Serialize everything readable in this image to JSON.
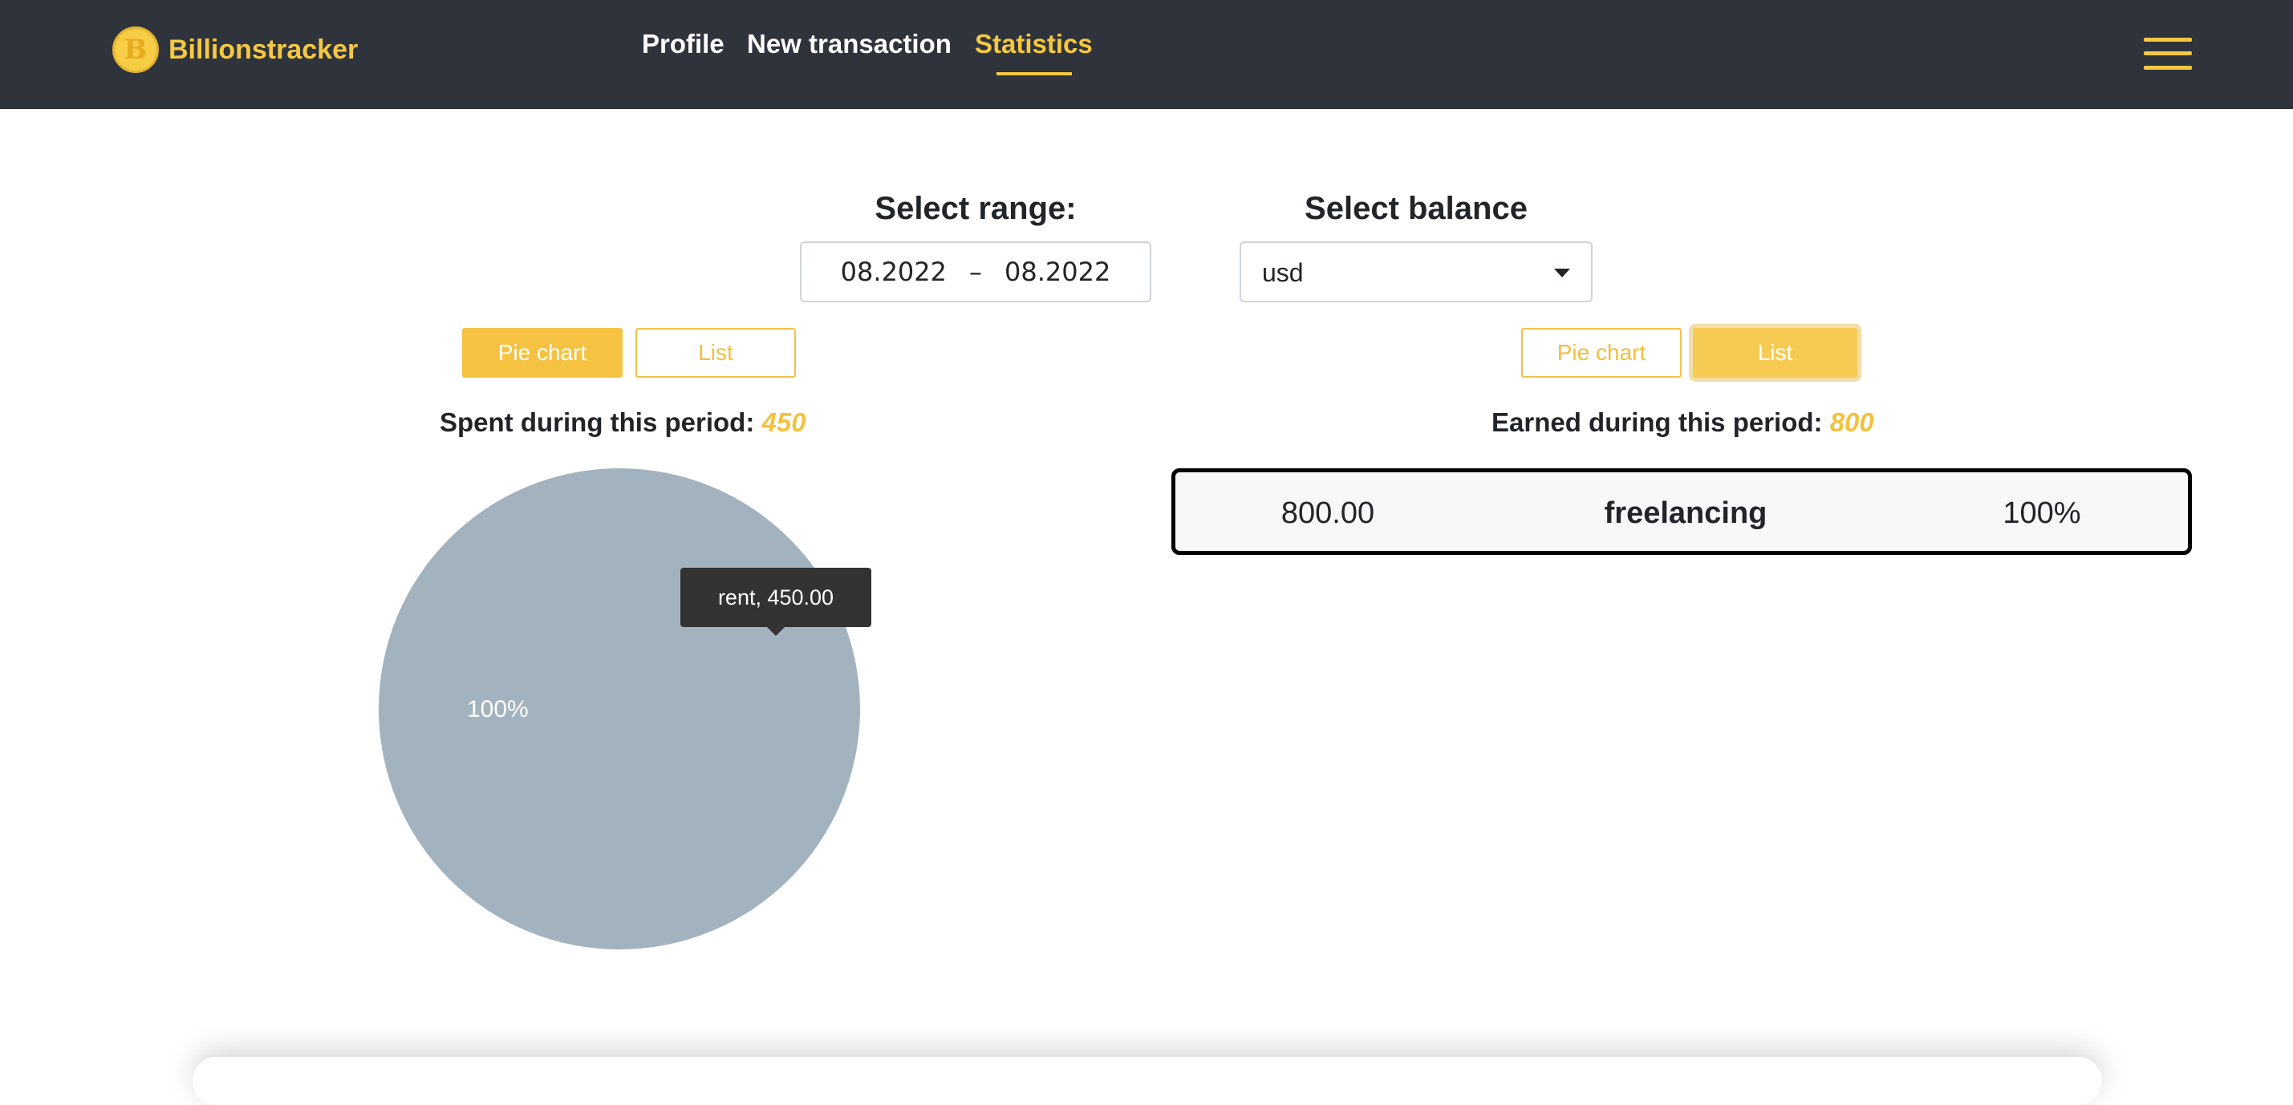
{
  "brand": {
    "coin_glyph": "B",
    "name": "Billionstracker",
    "color": "#f5c842"
  },
  "nav": {
    "profile": "Profile",
    "new_transaction": "New transaction",
    "statistics": "Statistics",
    "active": "statistics",
    "menu_icon": "hamburger-icon"
  },
  "filters": {
    "range_label": "Select range:",
    "range_from": "08.2022",
    "range_separator": "–",
    "range_to": "08.2022",
    "balance_label": "Select balance",
    "balance_value": "usd"
  },
  "spent": {
    "toggle_pie": "Pie chart",
    "toggle_list": "List",
    "active_view": "pie",
    "label": "Spent during this period:",
    "amount": "450"
  },
  "earned": {
    "toggle_pie": "Pie chart",
    "toggle_list": "List",
    "active_view": "list",
    "label": "Earned during this period:",
    "amount": "800",
    "rows": [
      {
        "amount": "800.00",
        "category": "freelancing",
        "percent": "100%"
      }
    ]
  },
  "chart_data": {
    "type": "pie",
    "slices": [
      {
        "label": "rent",
        "value": 450,
        "percent_label": "100%",
        "color": "#a2b3bf"
      }
    ],
    "tooltip": "rent, 450.00"
  },
  "colors": {
    "accent": "#f5c242",
    "navbar": "#2f333b",
    "pie": "#a2b3bf"
  }
}
